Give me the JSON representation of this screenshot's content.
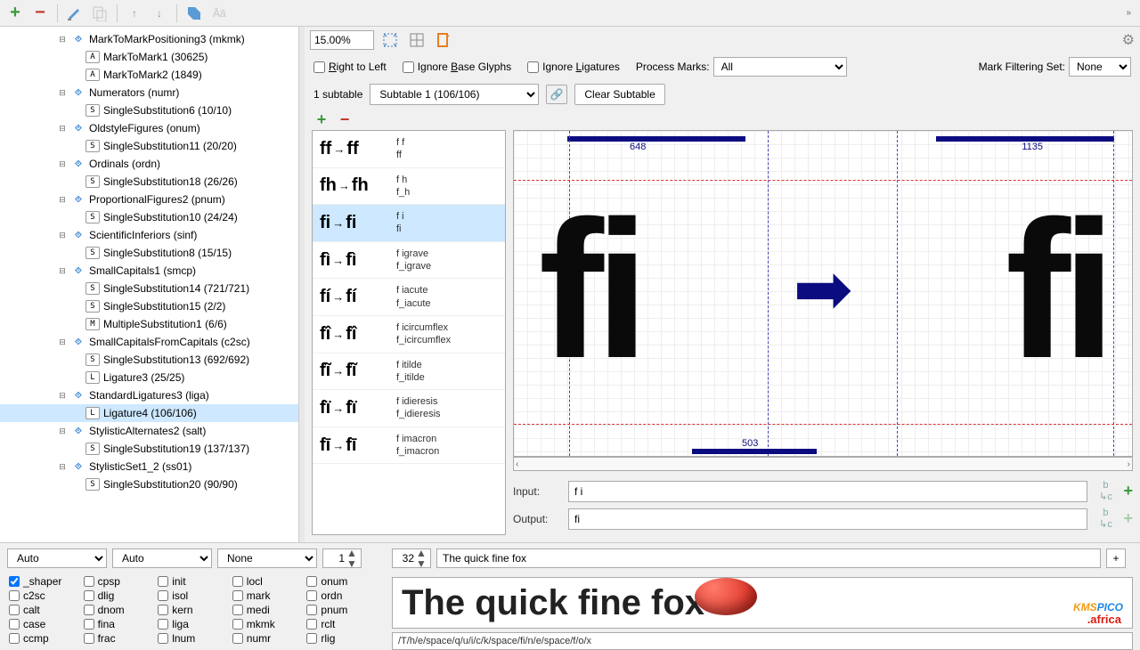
{
  "toolbar": {
    "zoom": "15.00%"
  },
  "options": {
    "rtl": "Right to Left",
    "ignore_base": "Ignore Base Glyphs",
    "ignore_liga": "Ignore Ligatures",
    "process_marks_label": "Process Marks:",
    "process_marks_value": "All",
    "mark_filtering_label": "Mark Filtering Set:",
    "mark_filtering_value": "None"
  },
  "subtable": {
    "count_label": "1 subtable",
    "selected": "Subtable 1 (106/106)",
    "clear_btn": "Clear Subtable"
  },
  "tree": [
    {
      "level": 1,
      "icon": "feat",
      "label": "MarkToMarkPositioning3 (mkmk)",
      "expandable": true
    },
    {
      "level": 2,
      "icon": "A",
      "label": "MarkToMark1 (30625)"
    },
    {
      "level": 2,
      "icon": "A",
      "label": "MarkToMark2 (1849)"
    },
    {
      "level": 1,
      "icon": "feat",
      "label": "Numerators (numr)",
      "expandable": true
    },
    {
      "level": 2,
      "icon": "S",
      "label": "SingleSubstitution6 (10/10)"
    },
    {
      "level": 1,
      "icon": "feat",
      "label": "OldstyleFigures (onum)",
      "expandable": true
    },
    {
      "level": 2,
      "icon": "S",
      "label": "SingleSubstitution11 (20/20)"
    },
    {
      "level": 1,
      "icon": "feat",
      "label": "Ordinals (ordn)",
      "expandable": true
    },
    {
      "level": 2,
      "icon": "S",
      "label": "SingleSubstitution18 (26/26)"
    },
    {
      "level": 1,
      "icon": "feat",
      "label": "ProportionalFigures2 (pnum)",
      "expandable": true
    },
    {
      "level": 2,
      "icon": "S",
      "label": "SingleSubstitution10 (24/24)"
    },
    {
      "level": 1,
      "icon": "feat",
      "label": "ScientificInferiors (sinf)",
      "expandable": true
    },
    {
      "level": 2,
      "icon": "S",
      "label": "SingleSubstitution8 (15/15)"
    },
    {
      "level": 1,
      "icon": "feat",
      "label": "SmallCapitals1 (smcp)",
      "expandable": true
    },
    {
      "level": 2,
      "icon": "S",
      "label": "SingleSubstitution14 (721/721)"
    },
    {
      "level": 2,
      "icon": "S",
      "label": "SingleSubstitution15 (2/2)"
    },
    {
      "level": 2,
      "icon": "M",
      "label": "MultipleSubstitution1 (6/6)"
    },
    {
      "level": 1,
      "icon": "feat",
      "label": "SmallCapitalsFromCapitals (c2sc)",
      "expandable": true
    },
    {
      "level": 2,
      "icon": "S",
      "label": "SingleSubstitution13 (692/692)"
    },
    {
      "level": 2,
      "icon": "L",
      "label": "Ligature3 (25/25)"
    },
    {
      "level": 1,
      "icon": "feat",
      "label": "StandardLigatures3 (liga)",
      "expandable": true
    },
    {
      "level": 2,
      "icon": "L",
      "label": "Ligature4 (106/106)",
      "selected": true
    },
    {
      "level": 1,
      "icon": "feat",
      "label": "StylisticAlternates2 (salt)",
      "expandable": true
    },
    {
      "level": 2,
      "icon": "S",
      "label": "SingleSubstitution19 (137/137)"
    },
    {
      "level": 1,
      "icon": "feat",
      "label": "StylisticSet1_2 (ss01)",
      "expandable": true
    },
    {
      "level": 2,
      "icon": "S",
      "label": "SingleSubstitution20 (90/90)"
    }
  ],
  "subst_items": [
    {
      "in": "f f",
      "out": "ff",
      "codes": [
        "f f",
        "ff"
      ]
    },
    {
      "in": "f h",
      "out": "fh",
      "codes": [
        "f h",
        "f_h"
      ]
    },
    {
      "in": "f i",
      "out": "fi",
      "codes": [
        "f i",
        "fi"
      ],
      "selected": true
    },
    {
      "in": "f ì",
      "out": "fì",
      "codes": [
        "f igrave",
        "f_igrave"
      ]
    },
    {
      "in": "f í",
      "out": "fí",
      "codes": [
        "f iacute",
        "f_iacute"
      ]
    },
    {
      "in": "f î",
      "out": "fî",
      "codes": [
        "f icircumflex",
        "f_icircumflex"
      ]
    },
    {
      "in": "f ĩ",
      "out": "fĩ",
      "codes": [
        "f itilde",
        "f_itilde"
      ]
    },
    {
      "in": "f ï",
      "out": "fï",
      "codes": [
        "f idieresis",
        "f_idieresis"
      ]
    },
    {
      "in": "f ī",
      "out": "fī",
      "codes": [
        "f imacron",
        "f_imacron"
      ]
    }
  ],
  "metrics": {
    "left_width": "648",
    "right_width": "1135",
    "kern": "503"
  },
  "io": {
    "input_label": "Input:",
    "input_value": "f i",
    "output_label": "Output:",
    "output_value": "fi"
  },
  "bottom": {
    "sel1": "Auto",
    "sel2": "Auto",
    "sel3": "None",
    "spin1": "1",
    "spin2": "32",
    "sample_text": "The quick fine fox",
    "sample_render": "The quick fine fox",
    "glyph_path": "/T/h/e/space/q/u/i/c/k/space/fi/n/e/space/f/o/x",
    "watermark_a": "KMS",
    "watermark_b": "PICO",
    "watermark_sub": ".africa"
  },
  "features": [
    [
      "_shaper",
      true
    ],
    [
      "cpsp",
      false
    ],
    [
      "init",
      false
    ],
    [
      "locl",
      false
    ],
    [
      "onum",
      false
    ],
    [
      "c2sc",
      false
    ],
    [
      "dlig",
      false
    ],
    [
      "isol",
      false
    ],
    [
      "mark",
      false
    ],
    [
      "ordn",
      false
    ],
    [
      "calt",
      false
    ],
    [
      "dnom",
      false
    ],
    [
      "kern",
      false
    ],
    [
      "medi",
      false
    ],
    [
      "pnum",
      false
    ],
    [
      "case",
      false
    ],
    [
      "fina",
      false
    ],
    [
      "liga",
      false
    ],
    [
      "mkmk",
      false
    ],
    [
      "rclt",
      false
    ],
    [
      "ccmp",
      false
    ],
    [
      "frac",
      false
    ],
    [
      "lnum",
      false
    ],
    [
      "numr",
      false
    ],
    [
      "rlig",
      false
    ]
  ]
}
